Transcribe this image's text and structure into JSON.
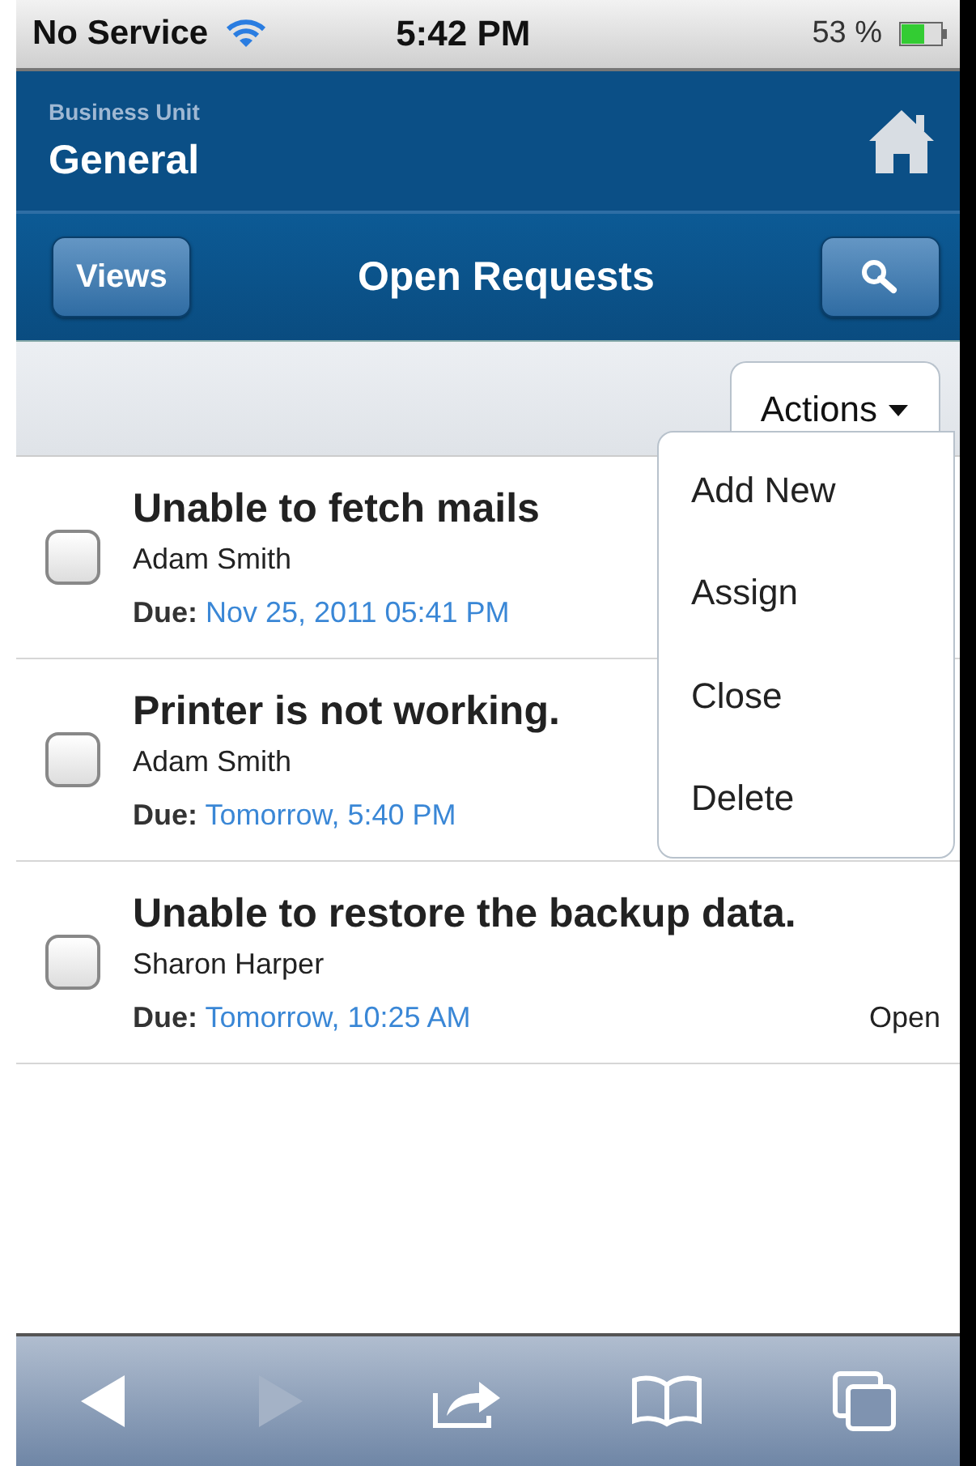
{
  "status_bar": {
    "carrier": "No Service",
    "time": "5:42 PM",
    "battery": "53 %"
  },
  "header": {
    "label": "Business Unit",
    "title": "General"
  },
  "toolbar": {
    "views_button": "Views",
    "title": "Open Requests"
  },
  "actions": {
    "label": "Actions",
    "expanded": true,
    "items": [
      "Add New",
      "Assign",
      "Close",
      "Delete"
    ]
  },
  "requests": [
    {
      "title": "Unable to fetch mails",
      "person": "Adam Smith",
      "due_label": "Due:",
      "due": "Nov 25, 2011 05:41 PM",
      "checked": false
    },
    {
      "title": "Printer is not working.",
      "person": "Adam Smith",
      "due_label": "Due:",
      "due": "Tomorrow, 5:40 PM",
      "checked": false
    },
    {
      "title": "Unable to restore the backup data.",
      "person": "Sharon Harper",
      "due_label": "Due:",
      "due": "Tomorrow, 10:25 AM",
      "status": "Open",
      "checked": false
    }
  ],
  "browser_bar": {
    "back_disabled": false,
    "forward_disabled": true
  }
}
